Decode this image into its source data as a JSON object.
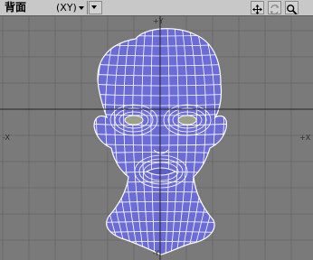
{
  "toolbar": {
    "view_title": "背面",
    "view_axis": "(XY)",
    "icons": [
      "move-view-icon",
      "rotate-view-icon",
      "zoom-view-icon"
    ]
  },
  "viewport": {
    "axis_labels": {
      "y_top": "+Y",
      "x_left": "-X",
      "x_right": "+X",
      "y_bottom": "-Y"
    },
    "colors": {
      "background": "#7a7a7a",
      "grid": "#6a6a6a",
      "axis": "#222222",
      "mesh_fill": "#6c6cd6",
      "mesh_wire": "#ffffff",
      "eye_fill": "#9aa08a"
    }
  }
}
